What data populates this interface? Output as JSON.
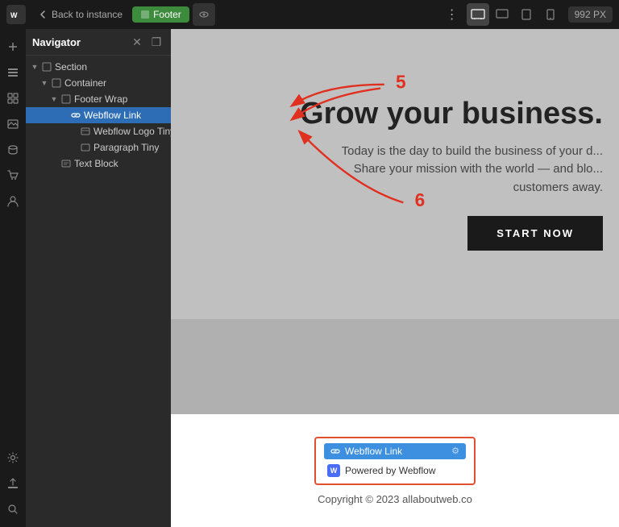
{
  "topBar": {
    "logo": "W",
    "backLabel": "Back to instance",
    "footerBadge": "Footer",
    "pxValue": "992 PX",
    "viewIcons": [
      "desktop-lg",
      "desktop",
      "tablet",
      "mobile"
    ],
    "activeView": "desktop-lg"
  },
  "navigator": {
    "title": "Navigator",
    "items": [
      {
        "id": "section",
        "label": "Section",
        "level": 0,
        "icon": "square",
        "hasArrow": true,
        "expanded": true
      },
      {
        "id": "container",
        "label": "Container",
        "level": 1,
        "icon": "square",
        "hasArrow": true,
        "expanded": true
      },
      {
        "id": "footer-wrap",
        "label": "Footer Wrap",
        "level": 2,
        "icon": "square",
        "hasArrow": true,
        "expanded": true
      },
      {
        "id": "webflow-link",
        "label": "Webflow Link",
        "level": 3,
        "icon": "link",
        "hasArrow": false,
        "expanded": false,
        "selected": true
      },
      {
        "id": "webflow-logo-tiny",
        "label": "Webflow Logo Tiny",
        "level": 4,
        "icon": "image",
        "hasArrow": false,
        "expanded": false
      },
      {
        "id": "paragraph-tiny",
        "label": "Paragraph Tiny",
        "level": 4,
        "icon": "paragraph",
        "hasArrow": false,
        "expanded": false
      },
      {
        "id": "text-block",
        "label": "Text Block",
        "level": 2,
        "icon": "text",
        "hasArrow": false,
        "expanded": false
      }
    ]
  },
  "canvas": {
    "heroTitle": "Grow your business.",
    "heroSubtitle": "Today is the day to build the business of your d...\nShare your mission with the world — and blo...\ncustomers away.",
    "heroButton": "START NOW",
    "footer": {
      "webflowLinkLabel": "Webflow Link",
      "poweredByLabel": "Powered by Webflow",
      "copyright": "Copyright © 2023 allaboutweb.co"
    }
  },
  "annotations": {
    "five": "5",
    "six": "6"
  },
  "colors": {
    "topBarBg": "#1a1a1a",
    "navigatorBg": "#2a2a2a",
    "selectedItem": "#2d6db5",
    "canvasBg": "#b0b0b0",
    "footerBg": "#ffffff",
    "accentRed": "#e03020",
    "webflowBlue": "#3d8fe0"
  }
}
